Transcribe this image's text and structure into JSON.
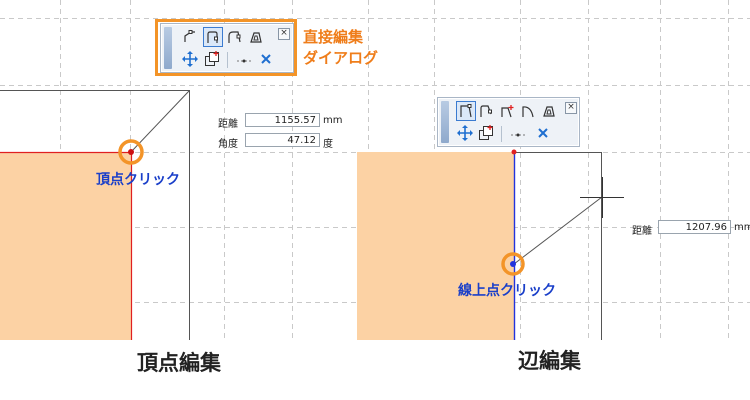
{
  "left_panel": {
    "dialog_callout": {
      "line1": "直接編集",
      "line2": "ダイアログ"
    },
    "toolbar": {
      "row1_icons": [
        "edit-vertex-icon",
        "edit-edge-icon",
        "fillet-edge-icon",
        "offset-shape-icon"
      ],
      "row2_icons": [
        "move-icon",
        "copy-shape-icon"
      ],
      "close_label": "×"
    },
    "readout": {
      "distance_label": "距離",
      "distance_value": "1155.57",
      "distance_unit": "mm",
      "angle_label": "角度",
      "angle_value": "47.12",
      "angle_unit": "度"
    },
    "click_label": "頂点クリック",
    "caption": "頂点編集"
  },
  "right_panel": {
    "toolbar": {
      "row1_icons": [
        "edit-vertex-icon",
        "edit-edge-icon",
        "add-vertex-icon",
        "arc-edge-icon",
        "offset-shape-icon"
      ],
      "row2_icons": [
        "move-icon",
        "copy-shape-icon"
      ],
      "close_label": "×"
    },
    "readout": {
      "distance_label": "距離",
      "distance_value": "1207.96",
      "distance_unit": "mm"
    },
    "click_label": "線上点クリック",
    "caption": "辺編集"
  },
  "colors": {
    "shape_fill": "#fcd2a4",
    "vertex_edge": "#e02020",
    "edge_highlight": "#2233dd",
    "callout_orange": "#f39428",
    "click_label_blue": "#1a3fc9"
  }
}
